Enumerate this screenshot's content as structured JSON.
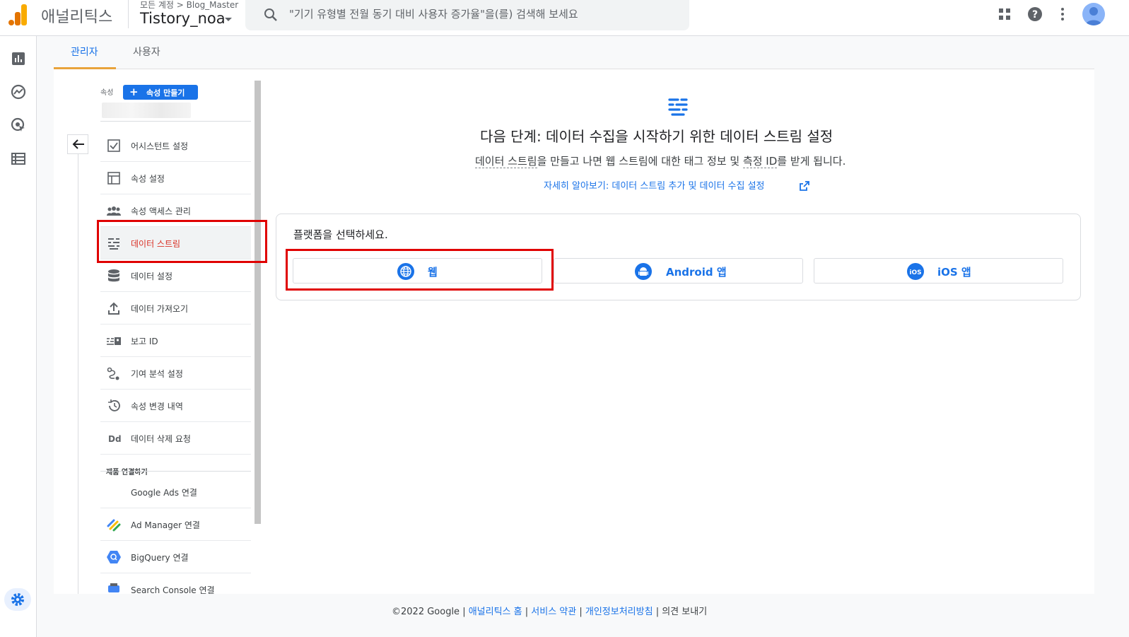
{
  "header": {
    "app_name": "애널리틱스",
    "breadcrumb": "모든 계정 > Blog_Master",
    "account_name": "Tistory_noa",
    "search_placeholder": "\"기기 유형별 전월 동기 대비 사용자 증가율\"을(를) 검색해 보세요"
  },
  "tabs": [
    {
      "label": "관리자",
      "active": true
    },
    {
      "label": "사용자",
      "active": false
    }
  ],
  "property": {
    "label": "속성",
    "create_button": "속성 만들기"
  },
  "nav_items": [
    {
      "label": "어시스턴트 설정",
      "icon": "checkbox-icon"
    },
    {
      "label": "속성 설정",
      "icon": "layout-icon"
    },
    {
      "label": "속성 액세스 관리",
      "icon": "people-icon"
    },
    {
      "label": "데이터 스트림",
      "icon": "stream-icon",
      "active": true
    },
    {
      "label": "데이터 설정",
      "icon": "database-icon"
    },
    {
      "label": "데이터 가져오기",
      "icon": "upload-icon"
    },
    {
      "label": "보고 ID",
      "icon": "report-id-icon"
    },
    {
      "label": "기여 분석 설정",
      "icon": "attribution-icon"
    },
    {
      "label": "속성 변경 내역",
      "icon": "history-icon"
    },
    {
      "label": "데이터 삭제 요청",
      "icon": "dd-icon"
    }
  ],
  "product_links": {
    "section_label": "제품 연결하기",
    "items": [
      {
        "label": "Google Ads 연결",
        "icon": "google-ads-icon"
      },
      {
        "label": "Ad Manager 연결",
        "icon": "ad-manager-icon"
      },
      {
        "label": "BigQuery 연결",
        "icon": "bigquery-icon"
      },
      {
        "label": "Search Console 연결",
        "icon": "search-console-icon"
      }
    ]
  },
  "main": {
    "title": "다음 단계: 데이터 수집을 시작하기 위한 데이터 스트림 설정",
    "desc_part1": "데이터 스트림",
    "desc_part2": "을 만들고 나면 웹 스트림에 대한 태그 정보 및 ",
    "desc_part3": "측정 ID",
    "desc_part4": "를 받게 됩니다.",
    "learn_more": "자세히 알아보기: 데이터 스트림 추가 및 데이터 수집 설정",
    "platform_prompt": "플랫폼을 선택하세요.",
    "platforms": [
      {
        "label": "웹",
        "icon": "globe-icon"
      },
      {
        "label": "Android 앱",
        "icon": "android-icon"
      },
      {
        "label": "iOS 앱",
        "icon": "ios-icon"
      }
    ]
  },
  "footer": {
    "copyright": "©2022 Google",
    "sep": " | ",
    "home": "애널리틱스 홈",
    "terms": "서비스 약관",
    "privacy": "개인정보처리방침",
    "feedback": "의견 보내기"
  },
  "colors": {
    "accent": "#1a73e8",
    "highlight": "#e00000",
    "tab_indicator": "#e8a33b"
  }
}
